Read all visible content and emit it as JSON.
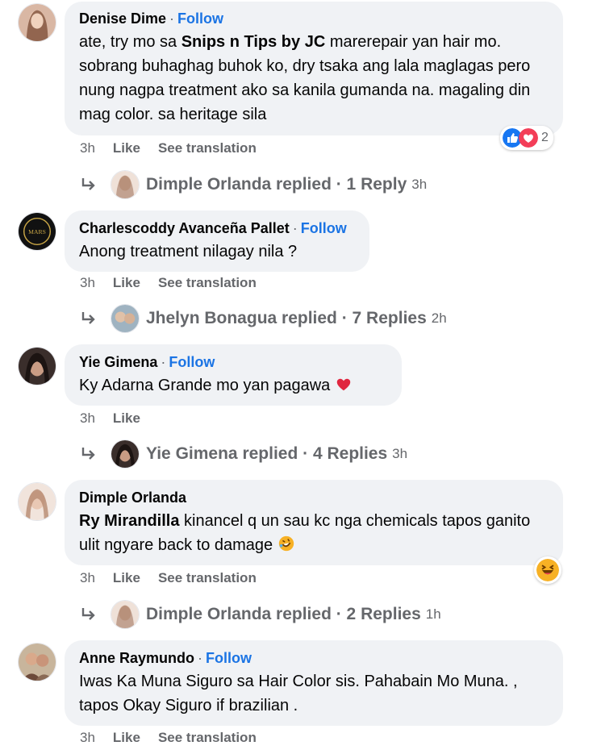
{
  "colors": {
    "follow": "#1b74e4",
    "meta": "#65676b",
    "bubble": "#f0f2f5",
    "like": "#1877f2",
    "love": "#f33e58",
    "haha": "#f7b125"
  },
  "comments": [
    {
      "author": "Denise Dime",
      "follow": "Follow",
      "text_mention": "Snips n Tips by JC",
      "text_pre": "ate, try mo sa ",
      "text_post": " marerepair yan hair mo. sobrang buhaghag buhok ko, dry tsaka ang lala maglagas pero nung nagpa treatment ako sa kanila gumanda na. magaling din mag color. sa heritage sila",
      "time": "3h",
      "like": "Like",
      "translate": "See translation",
      "reaction_count": "2",
      "reaction_icons": [
        "like-icon",
        "love-icon"
      ],
      "reply": {
        "text": "Dimple Orlanda replied · 1 Reply",
        "time": "3h"
      }
    },
    {
      "author": "Charlescoddy Avanceña Pallet",
      "follow": "Follow",
      "text": "Anong treatment nilagay nila ?",
      "time": "3h",
      "like": "Like",
      "translate": "See translation",
      "reply": {
        "text": "Jhelyn Bonagua replied · 7 Replies",
        "time": "2h"
      }
    },
    {
      "author": "Yie Gimena",
      "follow": "Follow",
      "text": "Ky Adarna Grande mo yan pagawa",
      "text_emoji": "heart-icon",
      "time": "3h",
      "like": "Like",
      "reply": {
        "text": "Yie Gimena replied · 4 Replies",
        "time": "3h"
      }
    },
    {
      "author": "Dimple Orlanda",
      "text_mention": "Ry Mirandilla",
      "text_pre": "",
      "text_post": " kinancel q un sau kc nga chemicals tapos ganito ulit ngyare back to damage",
      "text_emoji": "rolling-laugh-icon",
      "time": "3h",
      "like": "Like",
      "translate": "See translation",
      "reaction_icons": [
        "haha-icon"
      ],
      "reply": {
        "text": "Dimple Orlanda replied · 2 Replies",
        "time": "1h"
      }
    },
    {
      "author": "Anne Raymundo",
      "follow": "Follow",
      "text": "Iwas Ka Muna Siguro sa Hair Color sis. Pahabain Mo Muna. , tapos Okay Siguro if brazilian .",
      "time": "3h",
      "like": "Like",
      "translate": "See translation"
    }
  ]
}
